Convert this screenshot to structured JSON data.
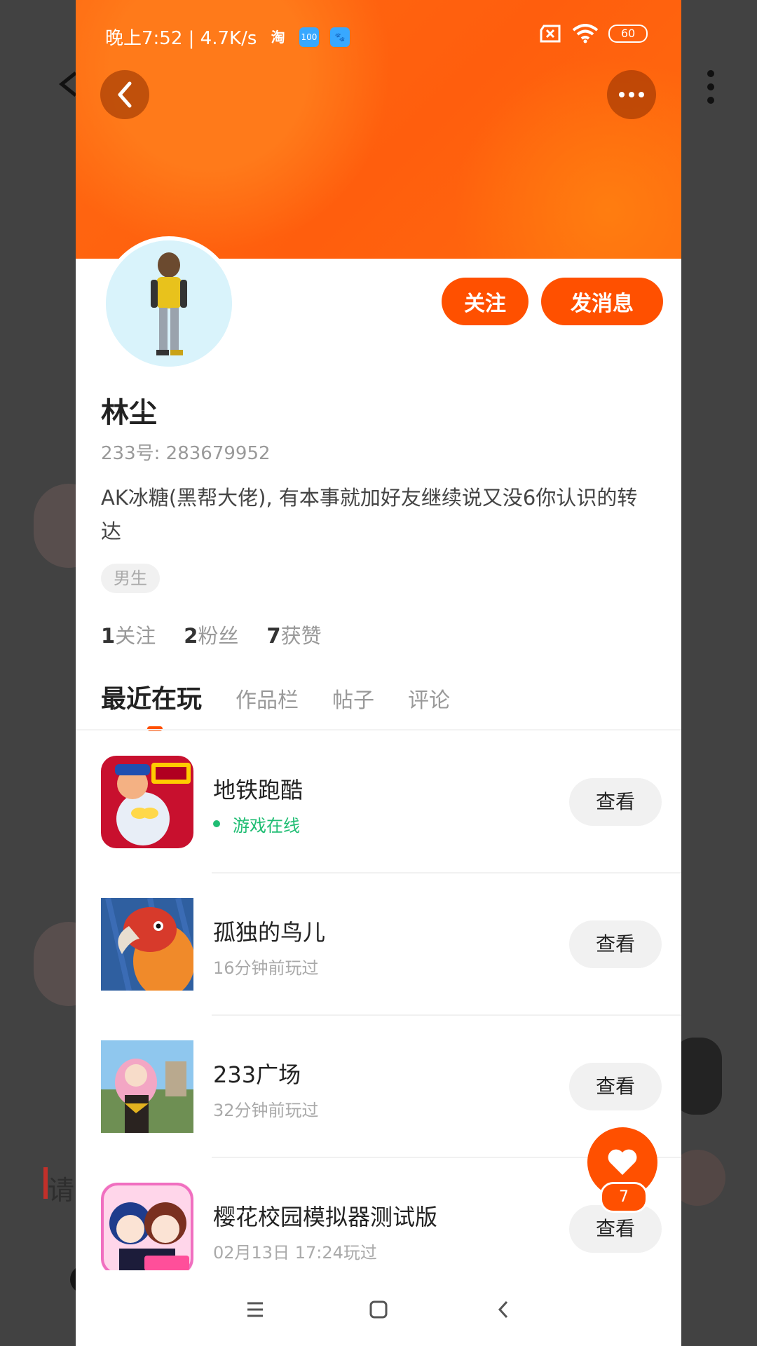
{
  "status_bar": {
    "time_speed": "晚上7:52 | 4.7K/s",
    "app_badges": [
      "淘",
      "100",
      "🐾"
    ],
    "battery": "60"
  },
  "profile": {
    "name": "林尘",
    "uid": "233号: 283679952",
    "bio": "AK冰糖(黑帮大佬), 有本事就加好友继续说又没6你认识的转达",
    "gender_tag": "男生",
    "follow_button": "关注",
    "message_button": "发消息",
    "stats": [
      {
        "value": "1",
        "label": "关注"
      },
      {
        "value": "2",
        "label": "粉丝"
      },
      {
        "value": "7",
        "label": "获赞"
      }
    ]
  },
  "tabs": [
    {
      "label": "最近在玩",
      "active": true
    },
    {
      "label": "作品栏",
      "active": false
    },
    {
      "label": "帖子",
      "active": false
    },
    {
      "label": "评论",
      "active": false
    }
  ],
  "games": [
    {
      "title": "地铁跑酷",
      "subtitle": "游戏在线",
      "online": true,
      "button": "查看"
    },
    {
      "title": "孤独的鸟儿",
      "subtitle": "16分钟前玩过",
      "online": false,
      "button": "查看"
    },
    {
      "title": "233广场",
      "subtitle": "32分钟前玩过",
      "online": false,
      "button": "查看"
    },
    {
      "title": "樱花校园模拟器测试版",
      "subtitle": "02月13日 17:24玩过",
      "online": false,
      "button": "查看"
    }
  ],
  "likes": {
    "count": "7"
  },
  "background": {
    "input_hint": "请"
  },
  "colors": {
    "accent": "#ff5000",
    "online": "#1fbd73"
  }
}
